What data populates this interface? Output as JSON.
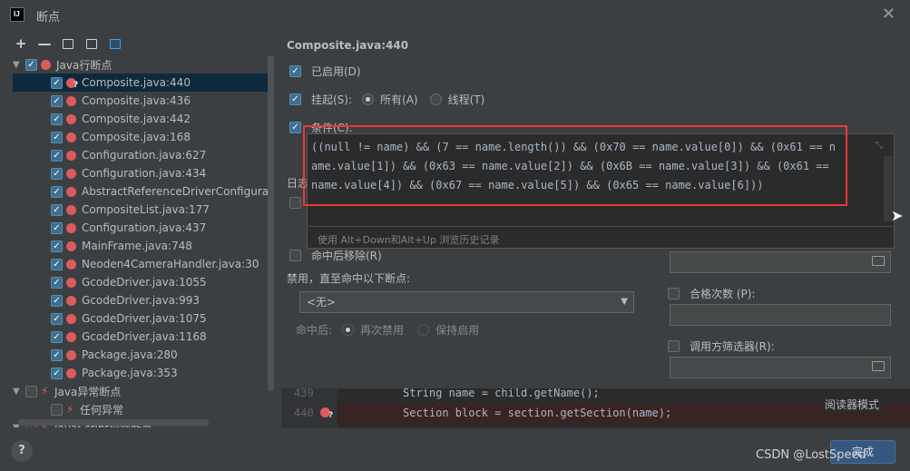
{
  "window": {
    "title": "断点",
    "logo": "IJ"
  },
  "toolbar": {
    "add": "+",
    "remove": "—"
  },
  "tree": {
    "java_line_group": "Java行断点",
    "items": [
      {
        "label": "Composite.java:440",
        "selected": true,
        "uncertain": true
      },
      {
        "label": "Composite.java:436"
      },
      {
        "label": "Composite.java:442"
      },
      {
        "label": "Composite.java:168"
      },
      {
        "label": "Configuration.java:627"
      },
      {
        "label": "Configuration.java:434"
      },
      {
        "label": "AbstractReferenceDriverConfigurationWi"
      },
      {
        "label": "CompositeList.java:177"
      },
      {
        "label": "Configuration.java:437"
      },
      {
        "label": "MainFrame.java:748"
      },
      {
        "label": "Neoden4CameraHandler.java:30"
      },
      {
        "label": "GcodeDriver.java:1055"
      },
      {
        "label": "GcodeDriver.java:993"
      },
      {
        "label": "GcodeDriver.java:1075"
      },
      {
        "label": "GcodeDriver.java:1168"
      },
      {
        "label": "Package.java:280"
      },
      {
        "label": "Package.java:353"
      }
    ],
    "java_exception_group": "Java异常断点",
    "any_exception": "任何异常",
    "js_exception_group": "JavaScript异常断点"
  },
  "details": {
    "title": "Composite.java:440",
    "enabled_label": "已启用(D)",
    "suspend_label": "挂起(S):",
    "suspend_all": "所有(A)",
    "suspend_thread": "线程(T)",
    "condition_label": "条件(C):",
    "condition_code": "((null != name) && (7 == name.length()) && (0x70 == name.value[0]) && (0x61 == name.value[1]) && (0x63 == name.value[2]) && (0x6B == name.value[3]) && (0x61 == name.value[4]) && (0x67 == name.value[5]) && (0x65 == name.value[6]))",
    "history_hint": "使用 Alt+Down和Alt+Up 浏览历史记录",
    "log_label_partial": "日志",
    "remove_on_hit": "命中后移除(R)",
    "disable_until": "禁用，直至命中以下断点:",
    "disable_until_value": "<无>",
    "after_hit": "命中后:",
    "disable_again": "再次禁用",
    "keep_enabled": "保持启用",
    "pass_count": "合格次数 (P):",
    "caller_filter": "调用方筛选器(R):"
  },
  "editor": {
    "line1_number": "439",
    "line1_code": "String name = child.getName();",
    "line2_number": "440",
    "line2_code": "Section block = section.getSection(name);",
    "reader_mode": "阅读器模式"
  },
  "footer": {
    "help": "?",
    "done": "完成"
  },
  "watermark": "CSDN @LostSpeed",
  "colors": {
    "accent": "#365880",
    "breakpoint": "#db5c5c",
    "highlight_box": "#e83a3a"
  }
}
